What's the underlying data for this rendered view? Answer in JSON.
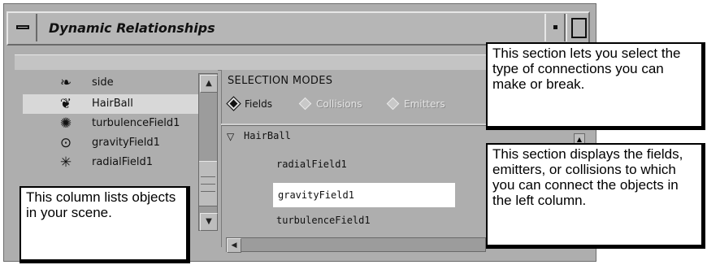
{
  "window": {
    "title": "Dynamic Relationships"
  },
  "objects": [
    {
      "label": "side",
      "icon": "curl-icon"
    },
    {
      "label": "HairBall",
      "icon": "hairball-icon",
      "selected": true
    },
    {
      "label": "turbulenceField1",
      "icon": "turbulence-field-icon"
    },
    {
      "label": "gravityField1",
      "icon": "gravity-field-icon"
    },
    {
      "label": "radialField1",
      "icon": "radial-field-icon"
    }
  ],
  "selection_modes": {
    "title": "SELECTION MODES",
    "options": [
      {
        "label": "Fields",
        "selected": true
      },
      {
        "label": "Collisions",
        "selected": false
      },
      {
        "label": "Emitters",
        "selected": false
      }
    ]
  },
  "tree": {
    "parent": "HairBall",
    "items": [
      "radialField1",
      "gravityField1",
      "turbulenceField1"
    ],
    "highlighted": "gravityField1"
  },
  "callouts": {
    "top": "This section lets you select the type of connections you can make or break.",
    "right": "This section displays the fields, emitters, or collisions to which you can connect the objects in the left column.",
    "left": "This column lists objects in your scene."
  },
  "colors": {
    "window_gray": "#aeaeae",
    "selected_row": "#d8d8d8",
    "highlight": "#ffffff"
  }
}
